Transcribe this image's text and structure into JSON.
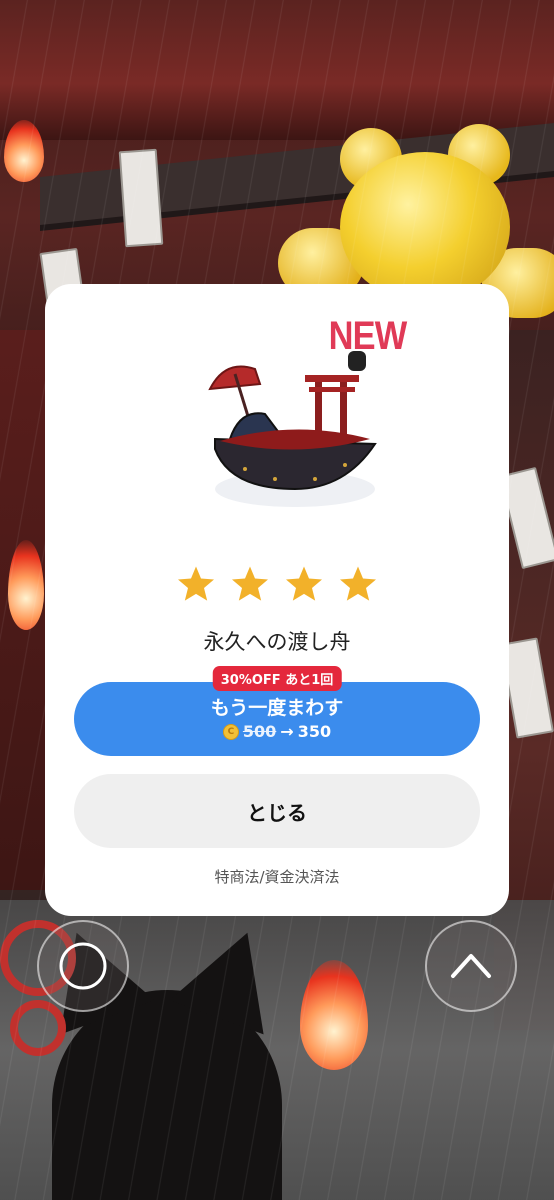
{
  "dialog": {
    "new_badge": "NEW",
    "rarity_stars": 4,
    "item_name": "永久への渡し舟",
    "discount_badge": "30%OFF あと1回",
    "spin_again_label": "もう一度まわす",
    "price_old": "500",
    "price_arrow": "→",
    "price_new": "350",
    "close_label": "とじる",
    "legal_link": "特商法/資金決済法"
  },
  "colors": {
    "accent_blue": "#3b8ced",
    "new_red": "#e03a57",
    "badge_red": "#e4283c",
    "star_gold": "#f2b12a"
  },
  "controls": {
    "left_icon": "circle-icon",
    "right_icon": "chevron-up-icon"
  }
}
